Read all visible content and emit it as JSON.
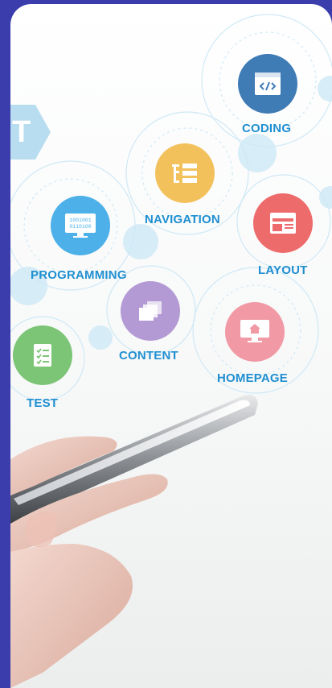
{
  "side_tab": {
    "letter": "T"
  },
  "nodes": [
    {
      "label": "CODING",
      "icon": "code-window-icon",
      "color": "#3f7bb5"
    },
    {
      "label": "NAVIGATION",
      "icon": "navigation-icon",
      "color": "#f2c15c"
    },
    {
      "label": "LAYOUT",
      "icon": "layout-icon",
      "color": "#ee6b6b"
    },
    {
      "label": "PROGRAMMING",
      "icon": "binary-monitor-icon",
      "color": "#4db0e8"
    },
    {
      "label": "CONTENT",
      "icon": "stacked-files-icon",
      "color": "#b39ad4"
    },
    {
      "label": "HOMEPAGE",
      "icon": "home-monitor-icon",
      "color": "#f19aa6"
    },
    {
      "label": "TEST",
      "icon": "checklist-icon",
      "color": "#7cc576"
    }
  ],
  "binary_text": {
    "line1": "1001001",
    "line2": "0110100"
  }
}
